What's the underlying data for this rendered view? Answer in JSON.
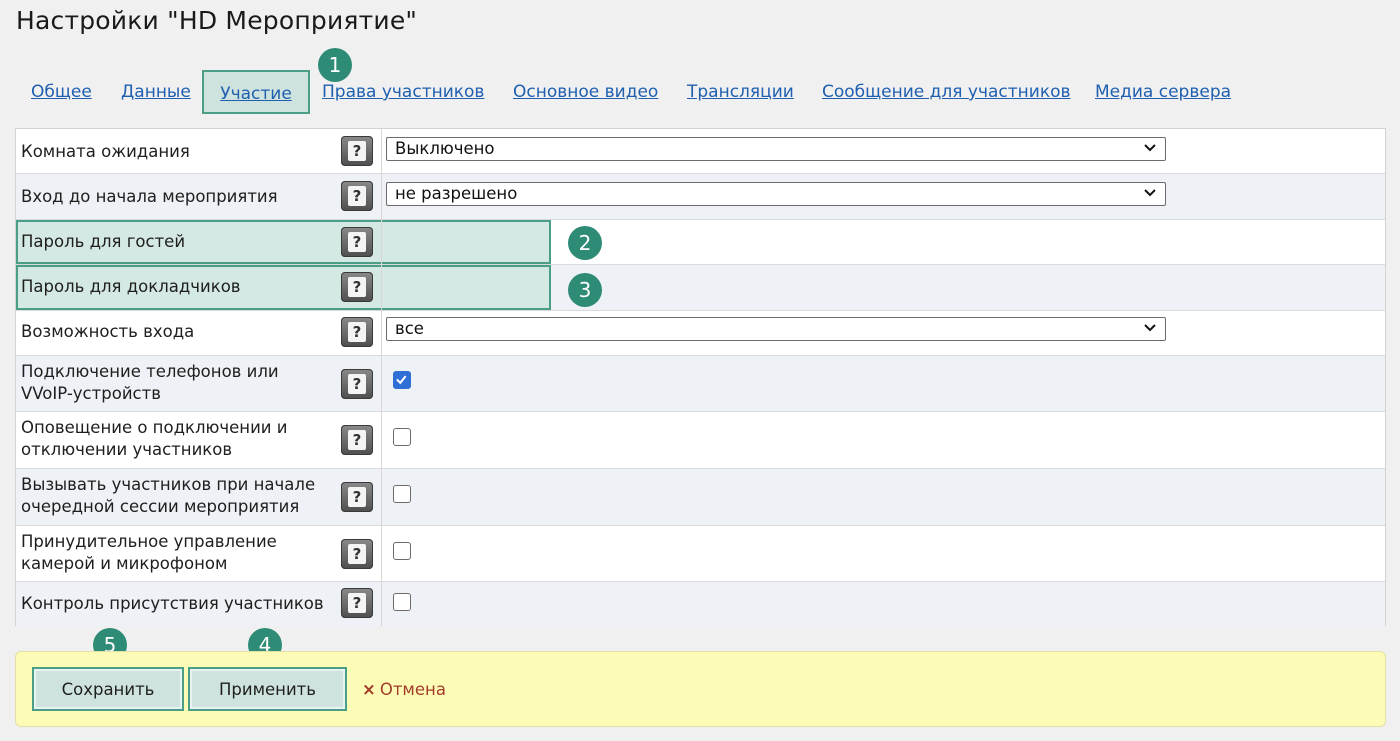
{
  "page": {
    "title": "Настройки \"HD Мероприятие\""
  },
  "tabs": [
    {
      "label": "Общее",
      "active": false
    },
    {
      "label": "Данные",
      "active": false
    },
    {
      "label": "Участие",
      "active": true
    },
    {
      "label": "Права участников",
      "active": false
    },
    {
      "label": "Основное видео",
      "active": false
    },
    {
      "label": "Трансляции",
      "active": false
    },
    {
      "label": "Сообщение для участников",
      "active": false
    },
    {
      "label": "Медиа сервера",
      "active": false
    }
  ],
  "badges": [
    "1",
    "2",
    "3",
    "4",
    "5"
  ],
  "help_icon": {
    "glyph": "?",
    "icon": "question-icon"
  },
  "settings": [
    {
      "label": "Комната ожидания",
      "control": "select",
      "value": "Выключено"
    },
    {
      "label": "Вход до начала мероприятия",
      "control": "select",
      "value": "не разрешено"
    },
    {
      "label": "Пароль для гостей",
      "control": "none",
      "highlighted": true
    },
    {
      "label": "Пароль для докладчиков",
      "control": "none",
      "highlighted": true
    },
    {
      "label": "Возможность входа",
      "control": "select",
      "value": "все"
    },
    {
      "label_line1": "Подключение телефонов или",
      "label_line2": "VVoIP-устройств",
      "control": "checkbox",
      "checked": true
    },
    {
      "label_line1": "Оповещение о подключении и",
      "label_line2": "отключении участников",
      "control": "checkbox",
      "checked": false
    },
    {
      "label_line1": "Вызывать участников при начале",
      "label_line2": "очередной сессии мероприятия",
      "control": "checkbox",
      "checked": false
    },
    {
      "label_line1": "Принудительное управление",
      "label_line2": "камерой и микрофоном",
      "control": "checkbox",
      "checked": false
    },
    {
      "label": "Контроль присутствия участников",
      "control": "checkbox",
      "checked": false
    }
  ],
  "footer": {
    "save_label": "Сохранить",
    "apply_label": "Применить",
    "cancel_icon": "×",
    "cancel_label": "Отмена"
  },
  "colors": {
    "accent": "#2e8b76",
    "link": "#1f5fb0",
    "highlight_bg": "#d5e9e4",
    "footer_bg": "#fdfcb7",
    "cancel": "#a23b2a",
    "checkbox_checked": "#2f6fd6"
  }
}
